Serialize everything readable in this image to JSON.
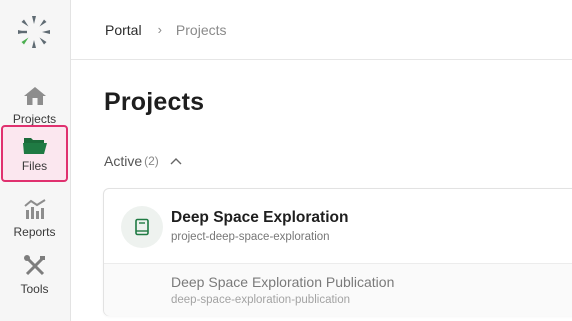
{
  "sidebar": {
    "items": [
      {
        "label": "Projects",
        "icon": "home-icon"
      },
      {
        "label": "Files",
        "icon": "folder-icon",
        "active": true
      },
      {
        "label": "Reports",
        "icon": "chart-icon"
      },
      {
        "label": "Tools",
        "icon": "tools-icon"
      }
    ]
  },
  "breadcrumb": {
    "root": "Portal",
    "separator": "›",
    "current": "Projects"
  },
  "page": {
    "title": "Projects"
  },
  "section": {
    "label": "Active",
    "count": "(2)"
  },
  "project": {
    "name": "Deep Space Exploration",
    "slug": "project-deep-space-exploration",
    "sub": {
      "name": "Deep Space Exploration Publication",
      "slug": "deep-space-exploration-publication"
    }
  },
  "colors": {
    "accent": "#e0316f",
    "folder": "#1f7a43",
    "logo_green": "#4caf50",
    "logo_gray": "#5f6b73"
  }
}
